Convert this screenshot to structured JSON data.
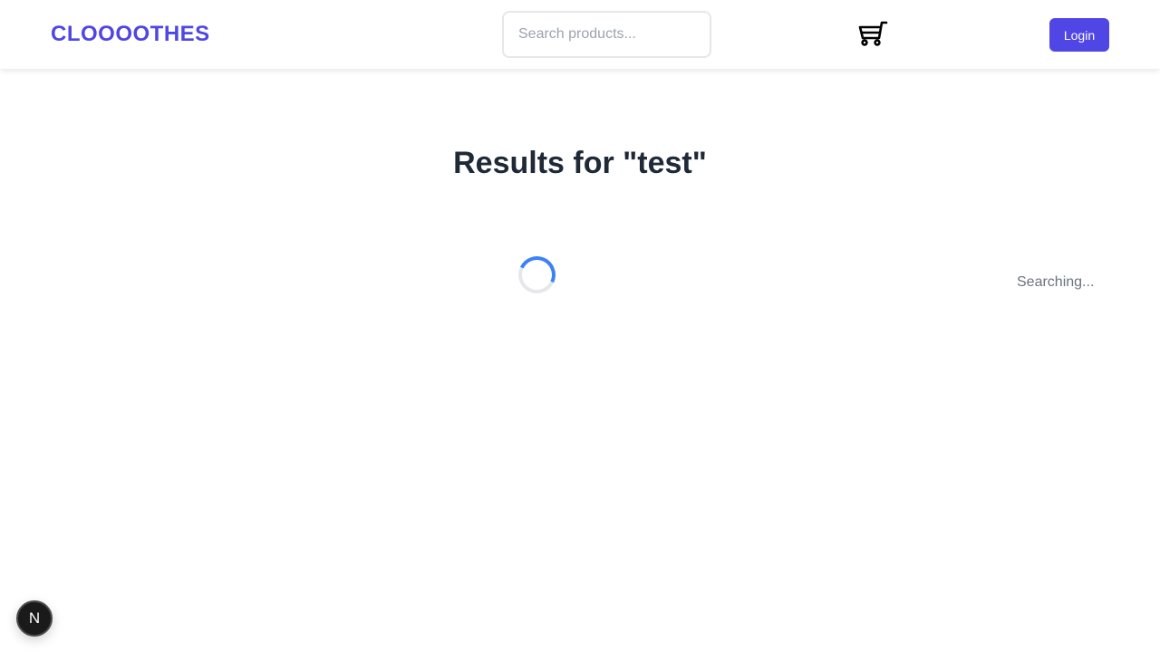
{
  "header": {
    "logo": "CLOOOOTHES",
    "search": {
      "placeholder": "Search products...",
      "value": ""
    },
    "cart_icon": "cart-icon",
    "login_label": "Login"
  },
  "main": {
    "title": "Results for \"test\"",
    "status": "Searching..."
  },
  "dev_badge": {
    "label": "N"
  },
  "colors": {
    "brand": "#4f46e5",
    "spinner": "#3b82f6",
    "title": "#1f2937",
    "muted": "#6b7280"
  }
}
